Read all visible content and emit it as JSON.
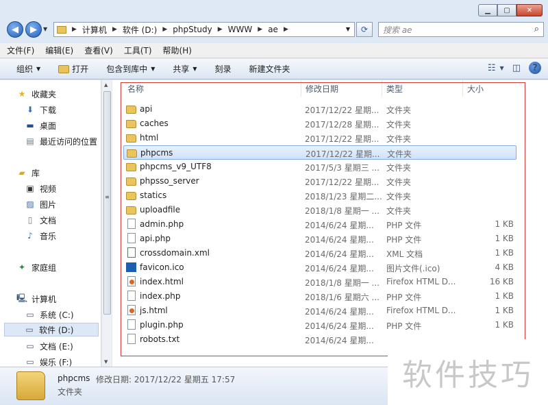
{
  "window": {
    "buttons": {
      "minimize": "▁",
      "maximize": "▢",
      "close": "✕"
    }
  },
  "address": {
    "segments": [
      "计算机",
      "软件 (D:)",
      "phpStudy",
      "WWW",
      "ae"
    ],
    "search_placeholder": "搜索 ae"
  },
  "menu": [
    "文件(F)",
    "编辑(E)",
    "查看(V)",
    "工具(T)",
    "帮助(H)"
  ],
  "toolbar": {
    "organize": "组织",
    "open": "打开",
    "include_in_library": "包含到库中",
    "share": "共享",
    "burn": "刻录",
    "new_folder": "新建文件夹"
  },
  "nav": {
    "favorites": "收藏夹",
    "downloads": "下载",
    "desktop": "桌面",
    "recent": "最近访问的位置",
    "libraries": "库",
    "videos": "视频",
    "pictures": "图片",
    "documents": "文档",
    "music": "音乐",
    "homegroup": "家庭组",
    "computer": "计算机",
    "drive_c": "系统 (C:)",
    "drive_d": "软件 (D:)",
    "drive_e": "文档 (E:)",
    "drive_f": "娱乐 (F:)"
  },
  "columns": {
    "name": "名称",
    "date": "修改日期",
    "type": "类型",
    "size": "大小"
  },
  "files": [
    {
      "name": "api",
      "date": "2017/12/22 星期...",
      "type": "文件夹",
      "size": "",
      "icon": "folder"
    },
    {
      "name": "caches",
      "date": "2017/12/28 星期...",
      "type": "文件夹",
      "size": "",
      "icon": "folder"
    },
    {
      "name": "html",
      "date": "2017/12/22 星期...",
      "type": "文件夹",
      "size": "",
      "icon": "folder"
    },
    {
      "name": "phpcms",
      "date": "2017/12/22 星期...",
      "type": "文件夹",
      "size": "",
      "icon": "folder"
    },
    {
      "name": "phpcms_v9_UTF8",
      "date": "2017/5/3 星期三 ...",
      "type": "文件夹",
      "size": "",
      "icon": "folder"
    },
    {
      "name": "phpsso_server",
      "date": "2017/12/22 星期...",
      "type": "文件夹",
      "size": "",
      "icon": "folder"
    },
    {
      "name": "statics",
      "date": "2018/1/23 星期二...",
      "type": "文件夹",
      "size": "",
      "icon": "folder"
    },
    {
      "name": "uploadfile",
      "date": "2018/1/8 星期一 ...",
      "type": "文件夹",
      "size": "",
      "icon": "folder"
    },
    {
      "name": "admin.php",
      "date": "2014/6/24 星期...",
      "type": "PHP 文件",
      "size": "1 KB",
      "icon": "doc"
    },
    {
      "name": "api.php",
      "date": "2014/6/24 星期...",
      "type": "PHP 文件",
      "size": "1 KB",
      "icon": "doc"
    },
    {
      "name": "crossdomain.xml",
      "date": "2014/6/24 星期...",
      "type": "XML 文档",
      "size": "1 KB",
      "icon": "xml"
    },
    {
      "name": "favicon.ico",
      "date": "2014/6/24 星期...",
      "type": "图片文件(.ico)",
      "size": "4 KB",
      "icon": "ico"
    },
    {
      "name": "index.html",
      "date": "2018/1/8 星期一 ...",
      "type": "Firefox HTML D...",
      "size": "16 KB",
      "icon": "ff"
    },
    {
      "name": "index.php",
      "date": "2018/1/6 星期六 ...",
      "type": "PHP 文件",
      "size": "1 KB",
      "icon": "doc"
    },
    {
      "name": "js.html",
      "date": "2014/6/24 星期...",
      "type": "Firefox HTML D...",
      "size": "1 KB",
      "icon": "ff"
    },
    {
      "name": "plugin.php",
      "date": "2014/6/24 星期...",
      "type": "PHP 文件",
      "size": "1 KB",
      "icon": "doc"
    },
    {
      "name": "robots.txt",
      "date": "2014/6/24 星期...",
      "type": "",
      "size": "",
      "icon": "doc"
    }
  ],
  "selected_index": 3,
  "details": {
    "name": "phpcms",
    "meta": "修改日期: 2017/12/22 星期五 17:57",
    "type": "文件夹"
  },
  "watermark": "软件技巧",
  "colors": {
    "selection": "#cfe2fb",
    "frame": "#d43a3a",
    "folder": "#e9c55b"
  }
}
